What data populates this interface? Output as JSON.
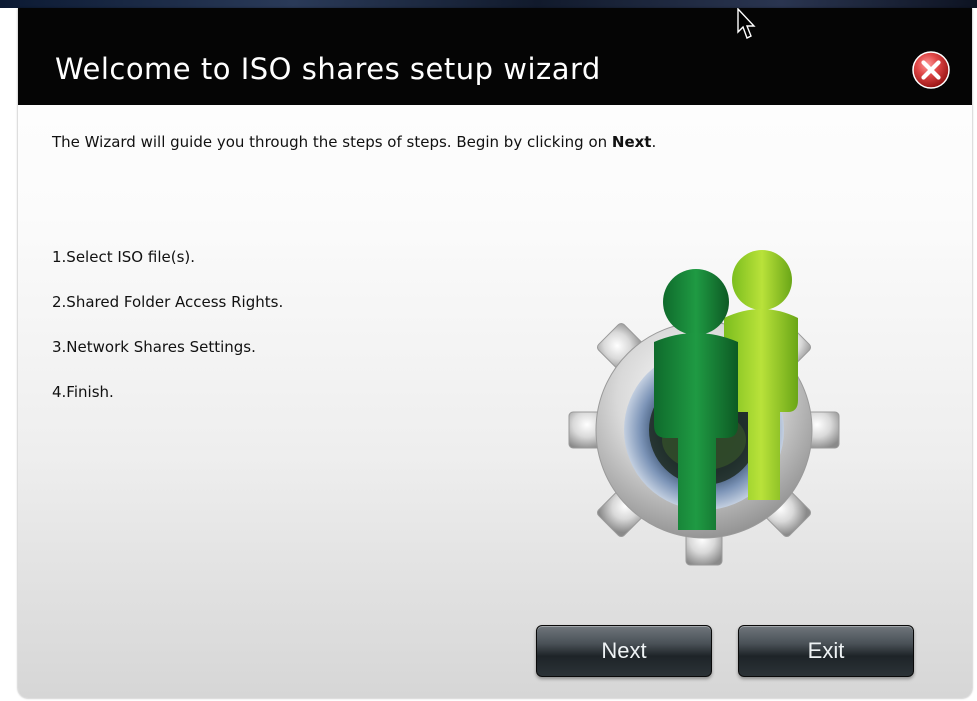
{
  "dialog": {
    "title": "Welcome to ISO shares setup wizard",
    "intro_text": "The Wizard will guide you through the steps of steps. Begin by clicking on ",
    "intro_bold": "Next",
    "intro_end": ".",
    "steps": [
      "1.Select ISO file(s).",
      "2.Shared Folder Access Rights.",
      "3.Network Shares Settings.",
      "4.Finish."
    ],
    "buttons": {
      "next": "Next",
      "exit": "Exit"
    }
  },
  "icons": {
    "close": "close-icon",
    "illustration": "users-gear-icon",
    "cursor": "mouse-cursor-icon"
  },
  "colors": {
    "title_bar": "#050505",
    "close_red": "#d23a3a",
    "button_dark": "#1e2428"
  }
}
